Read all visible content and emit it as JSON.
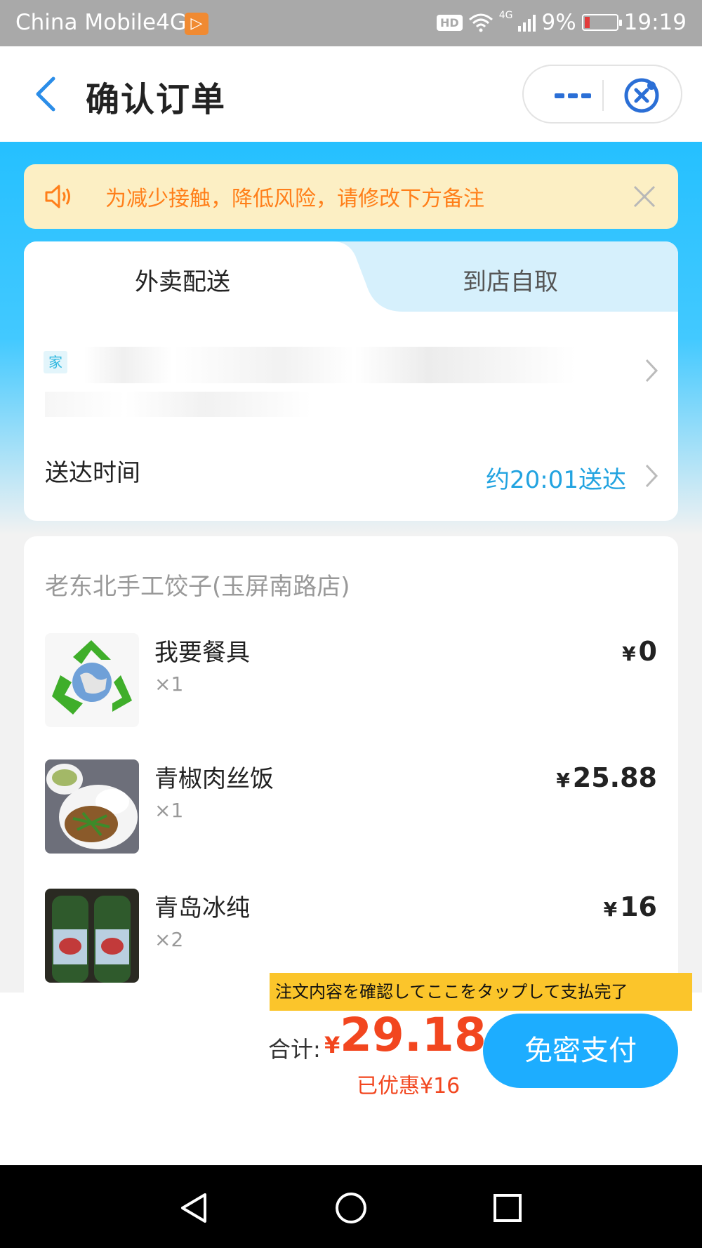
{
  "status_bar": {
    "carrier": "China Mobile4G",
    "hd": "HD",
    "network": "4G",
    "battery_percent": "9%",
    "time": "19:19"
  },
  "nav": {
    "title": "确认订单"
  },
  "notice": {
    "text": "为减少接触，降低风险，请修改下方备注"
  },
  "delivery": {
    "tabs": [
      "外卖配送",
      "到店自取"
    ],
    "address_tag": "家",
    "time_label": "送达时间",
    "time_value": "约20:01送达"
  },
  "order": {
    "shop_name": "老东北手工饺子(玉屏南路店)",
    "currency": "¥",
    "items": [
      {
        "name": "我要餐具",
        "qty": "×1",
        "price": "0"
      },
      {
        "name": "青椒肉丝饭",
        "qty": "×1",
        "price": "25.88"
      },
      {
        "name": "青岛冰纯",
        "qty": "×2",
        "price": "16"
      }
    ]
  },
  "footer": {
    "hint": "注文内容を確認してここをタップして支払完了",
    "total_label": "合计:",
    "currency": "¥",
    "total_amount": "29.18",
    "discount": "已优惠¥16",
    "pay_label": "免密支付"
  },
  "colors": {
    "accent_blue": "#1dadff",
    "price_red": "#f2461f",
    "notice_orange": "#ff7f1a",
    "hint_yellow": "#fbc52b"
  }
}
